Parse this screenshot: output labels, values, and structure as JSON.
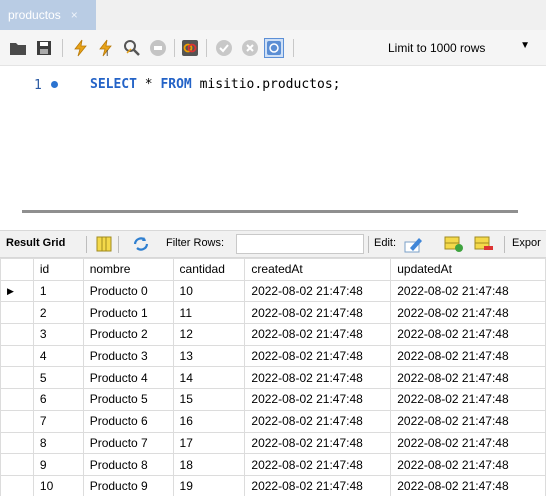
{
  "tab": {
    "title": "productos",
    "close": "×"
  },
  "toolbar": {
    "limit_label": "Limit to 1000 rows",
    "icons": [
      "open-folder-icon",
      "save-icon",
      "execute-icon",
      "execute-current-icon",
      "explain-icon",
      "stop-icon",
      "toggle-error-icon",
      "commit-icon",
      "rollback-icon",
      "autocommit-icon"
    ]
  },
  "editor": {
    "line_number": "1",
    "sql_keyword_select": "SELECT",
    "sql_star": " * ",
    "sql_keyword_from": "FROM",
    "sql_rest": " misitio.productos;"
  },
  "result_toolbar": {
    "result_grid": "Result Grid",
    "filter_rows": "Filter Rows:",
    "edit": "Edit:",
    "export": "Expor"
  },
  "grid": {
    "columns": [
      "id",
      "nombre",
      "cantidad",
      "createdAt",
      "updatedAt"
    ],
    "rows": [
      [
        "1",
        "Producto 0",
        "10",
        "2022-08-02 21:47:48",
        "2022-08-02 21:47:48"
      ],
      [
        "2",
        "Producto 1",
        "11",
        "2022-08-02 21:47:48",
        "2022-08-02 21:47:48"
      ],
      [
        "3",
        "Producto 2",
        "12",
        "2022-08-02 21:47:48",
        "2022-08-02 21:47:48"
      ],
      [
        "4",
        "Producto 3",
        "13",
        "2022-08-02 21:47:48",
        "2022-08-02 21:47:48"
      ],
      [
        "5",
        "Producto 4",
        "14",
        "2022-08-02 21:47:48",
        "2022-08-02 21:47:48"
      ],
      [
        "6",
        "Producto 5",
        "15",
        "2022-08-02 21:47:48",
        "2022-08-02 21:47:48"
      ],
      [
        "7",
        "Producto 6",
        "16",
        "2022-08-02 21:47:48",
        "2022-08-02 21:47:48"
      ],
      [
        "8",
        "Producto 7",
        "17",
        "2022-08-02 21:47:48",
        "2022-08-02 21:47:48"
      ],
      [
        "9",
        "Producto 8",
        "18",
        "2022-08-02 21:47:48",
        "2022-08-02 21:47:48"
      ],
      [
        "10",
        "Producto 9",
        "19",
        "2022-08-02 21:47:48",
        "2022-08-02 21:47:48"
      ]
    ],
    "current_row_marker": "▶"
  },
  "colors": {
    "tab_active": "#b9cce4",
    "keyword": "#2463c7",
    "line_number": "#2b5aa3"
  }
}
